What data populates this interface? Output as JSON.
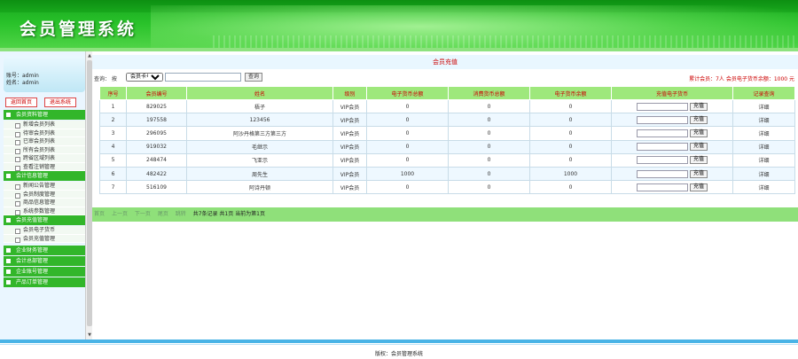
{
  "app": {
    "title": "会员管理系统"
  },
  "user": {
    "account_label": "账号：admin",
    "name_label": "姓名：admin"
  },
  "buttons": {
    "home": "返回首页",
    "exit": "退出系统"
  },
  "menu": {
    "cat1": "会员资料管理",
    "items1": [
      "新增会员列表",
      "待审会员列表",
      "已审会员列表",
      "所有会员列表",
      "跨省区域列表",
      "查看注销管理"
    ],
    "cat2": "会计信息管理",
    "items2": [
      "新闻公告管理",
      "会员制度管理",
      "商品信息管理",
      "系统参数管理"
    ],
    "cat3": "会员充值管理",
    "items3": [
      "会员电子货币",
      "会员充值管理"
    ],
    "cat4": "企业财务管理",
    "cat5": "会计总部管理",
    "cat6": "企业账号管理",
    "cat7": "产品订单管理"
  },
  "main": {
    "section_title": "会员充值",
    "search_label": "查询：  按",
    "search_select": "会员卡号",
    "search_value": "",
    "search_button": "查询",
    "stats": "累计会员：7人   会员电子货币余额：1000 元"
  },
  "table": {
    "headers": [
      "序号",
      "会员编号",
      "姓名",
      "级别",
      "电子货币总额",
      "消费货币总额",
      "电子货币余额",
      "充值电子货币",
      "记录查询"
    ],
    "recharge_button": "充值",
    "detail_label": "详细",
    "rows": [
      [
        "1",
        "829025",
        "梧子",
        "VIP会员",
        "0",
        "0",
        "0"
      ],
      [
        "2",
        "197558",
        "123456",
        "VIP会员",
        "0",
        "0",
        "0"
      ],
      [
        "3",
        "296095",
        "阿沙丹格第三方第三方",
        "VIP会员",
        "0",
        "0",
        "0"
      ],
      [
        "4",
        "919032",
        "毛继示",
        "VIP会员",
        "0",
        "0",
        "0"
      ],
      [
        "5",
        "248474",
        "飞亚示",
        "VIP会员",
        "0",
        "0",
        "0"
      ],
      [
        "6",
        "482422",
        "周先生",
        "VIP会员",
        "1000",
        "0",
        "1000"
      ],
      [
        "7",
        "516109",
        "阿诗丹顿",
        "VIP会员",
        "0",
        "0",
        "0"
      ]
    ]
  },
  "pager": {
    "first": "首页",
    "prev": "上一页",
    "next": "下一页",
    "last": "尾页",
    "go": "跳转",
    "info": "共7条记录 共1页 当前为第1页"
  },
  "footer": {
    "text": "版权：会员管理系统"
  }
}
